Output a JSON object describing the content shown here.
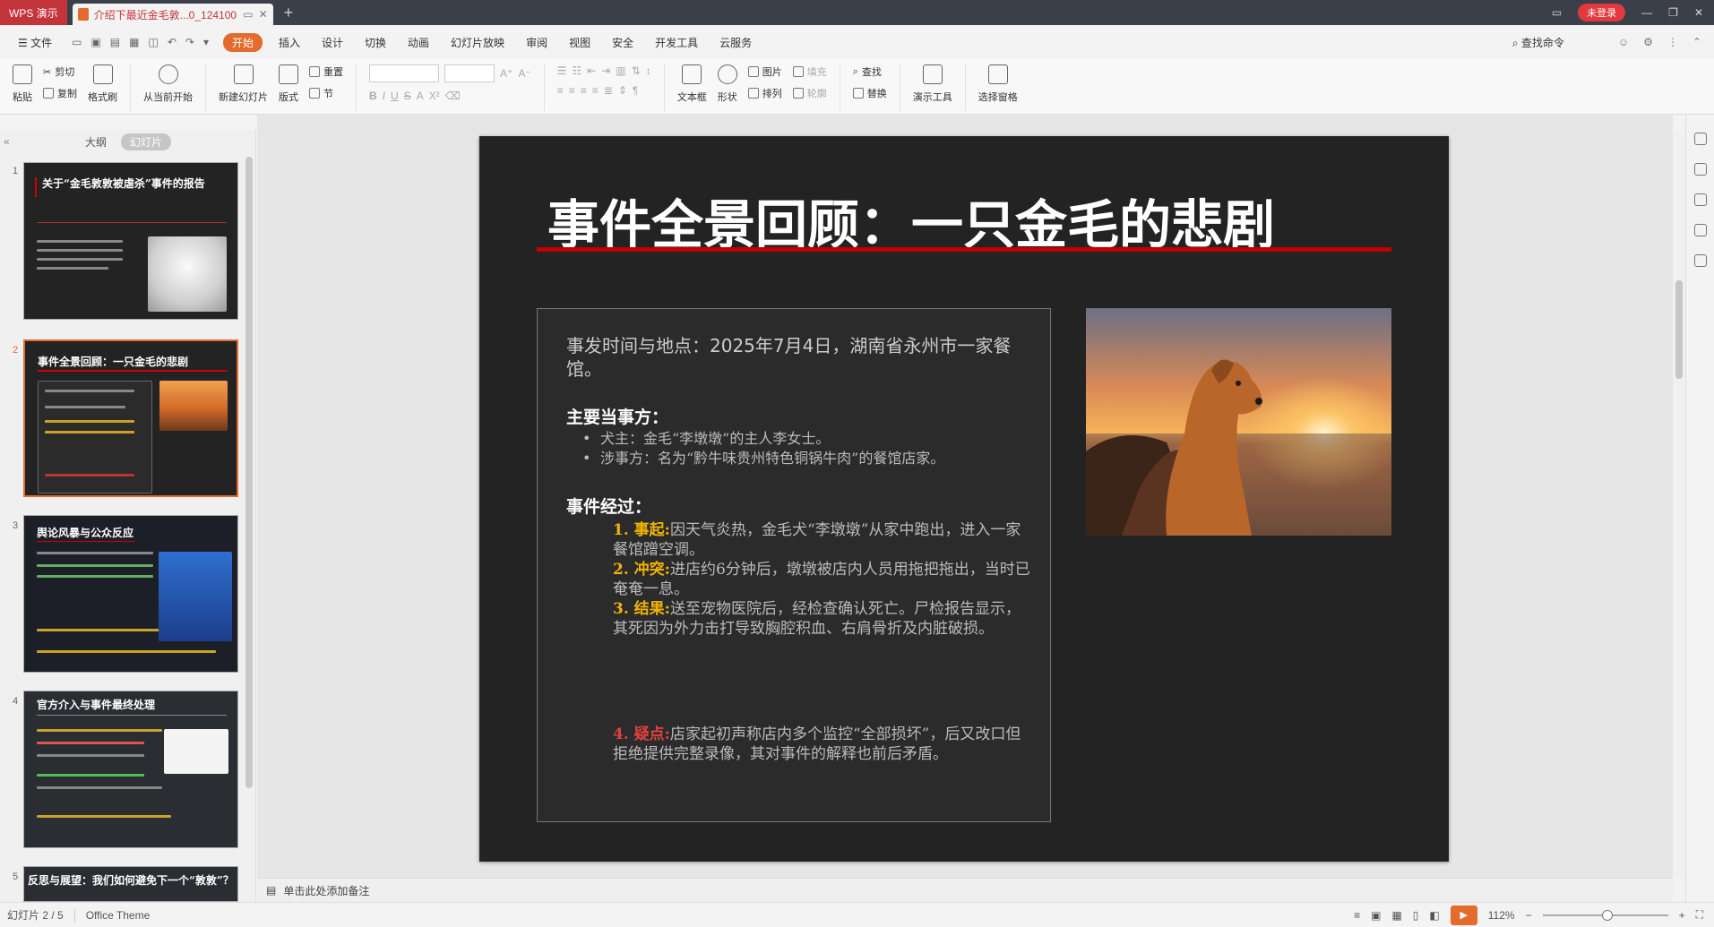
{
  "titlebar": {
    "app_name": "WPS 演示",
    "doc_tab": "介绍下最近金毛敦...0_124100",
    "new_tab": "+",
    "login": "未登录"
  },
  "menu": {
    "file": "☰ 文件",
    "items": [
      "开始",
      "插入",
      "设计",
      "切换",
      "动画",
      "幻灯片放映",
      "审阅",
      "视图",
      "安全",
      "开发工具",
      "云服务"
    ],
    "search": "查找命令"
  },
  "ribbon": {
    "paste": "粘贴",
    "cut": "剪切",
    "copy": "复制",
    "format_painter": "格式刷",
    "from_current": "从当前开始",
    "new_slide": "新建幻灯片",
    "layout": "版式",
    "reset": "重置",
    "section": "节",
    "textbox": "文本框",
    "shape": "形状",
    "picture": "图片",
    "arrange": "排列",
    "fill": "填充",
    "outline": "轮廓",
    "find": "查找",
    "replace": "替换",
    "present_tools": "演示工具",
    "selection_pane": "选择窗格"
  },
  "panel": {
    "tab_outline": "大纲",
    "tab_slides": "幻灯片",
    "thumbs": [
      {
        "num": "1",
        "title": "关于“金毛敦敦被虐杀”事件的报告"
      },
      {
        "num": "2",
        "title": "事件全景回顾：一只金毛的悲剧"
      },
      {
        "num": "3",
        "title": "舆论风暴与公众反应"
      },
      {
        "num": "4",
        "title": "官方介入与事件最终处理"
      },
      {
        "num": "5",
        "title": "反思与展望：我们如何避免下一个“敦敦”？"
      }
    ]
  },
  "slide": {
    "title": "事件全景回顾：一只金毛的悲剧",
    "time_place": "事发时间与地点：2025年7月4日，湖南省永州市一家餐馆。",
    "parties_head": "主要当事方：",
    "parties": [
      "犬主：金毛“李墩墩”的主人李女士。",
      "涉事方：名为“黔牛味贵州特色铜锅牛肉”的餐馆店家。"
    ],
    "process_head": "事件经过：",
    "steps": [
      {
        "label": "1. 事起:",
        "text": "因天气炎热，金毛犬“李墩墩”从家中跑出，进入一家餐馆蹭空调。"
      },
      {
        "label": "2. 冲突:",
        "text": "进店约6分钟后，墩墩被店内人员用拖把拖出，当时已奄奄一息。"
      },
      {
        "label": "3. 结果:",
        "text": "送至宠物医院后，经检查确认死亡。尸检报告显示，其死因为外力击打导致胸腔积血、右肩骨折及内脏破损。"
      },
      {
        "label": "4. 疑点:",
        "text": "店家起初声称店内多个监控“全部损坏”，后又改口但拒绝提供完整录像，其对事件的解释也前后矛盾。"
      }
    ]
  },
  "notes": {
    "placeholder": "单击此处添加备注"
  },
  "status": {
    "slide_count": "幻灯片 2 / 5",
    "theme": "Office Theme",
    "zoom": "112%",
    "minus": "−",
    "plus": "+"
  }
}
